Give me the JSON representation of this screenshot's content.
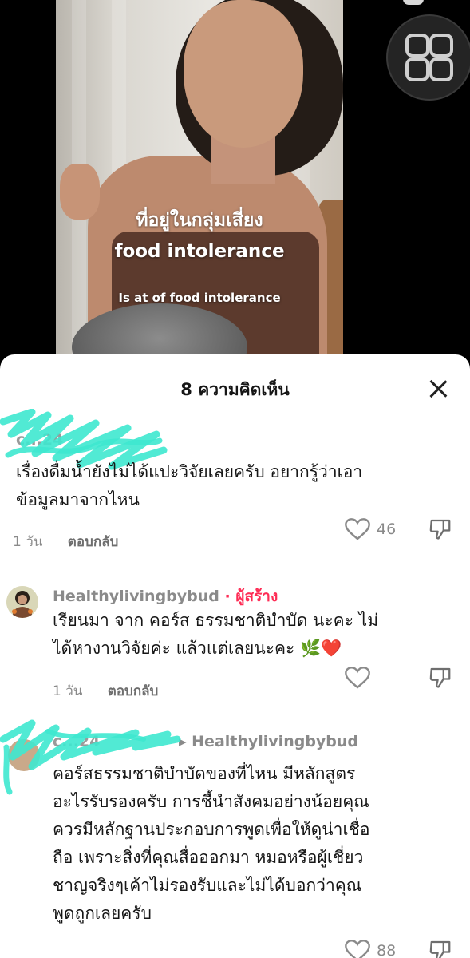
{
  "video": {
    "caption_line1": "ที่อยู่ในกลุ่มเสี่ยง",
    "caption_line2": "food intolerance",
    "caption_line3": "Is at of food intolerance"
  },
  "comments_sheet": {
    "title": "8 ความคิดเห็น",
    "comments": [
      {
        "username": "c...24",
        "text_lines": [
          "เรื่องดื่มน้ำยังไม่ได้แปะวิจัยเลยครับ อยากรู้ว่าเอา",
          "ข้อมูลมาจากไหน"
        ],
        "time": "1 วัน",
        "reply_label": "ตอบกลับ",
        "likes": "46"
      },
      {
        "username": "Healthylivingbybud",
        "creator_tag": "· ผู้สร้าง",
        "text_lines": [
          "เรียนมา จาก คอร์ส ธรรมชาติบำบัด นะคะ ไม่",
          "ได้หางานวิจัยค่ะ แล้วแต่เลยนะคะ 🌿❤️"
        ],
        "time": "1 วัน",
        "reply_label": "ตอบกลับ",
        "likes": ""
      },
      {
        "username": "c...24",
        "reply_to": "▸ Healthylivingbybud",
        "text_lines": [
          "คอร์สธรรมชาติบำบัดของที่ไหน มีหลักสูตร",
          "อะไรรับรองครับ การชี้นำสังคมอย่างน้อยคุณ",
          "ควรมีหลักฐานประกอบการพูดเพื่อให้ดูน่าเชื่อ",
          "ถือ เพราะสิ่งที่คุณสื่อออกมา หมอหรือผู้เชี่ยว",
          "ชาญจริงๆเค้าไม่รองรับและไม่ได้บอกว่าคุณ",
          "พูดถูกเลยครับ"
        ],
        "likes": "88"
      }
    ]
  },
  "colors": {
    "creator_tag": "#fe2c55",
    "scribble": "#3ee8cf"
  }
}
